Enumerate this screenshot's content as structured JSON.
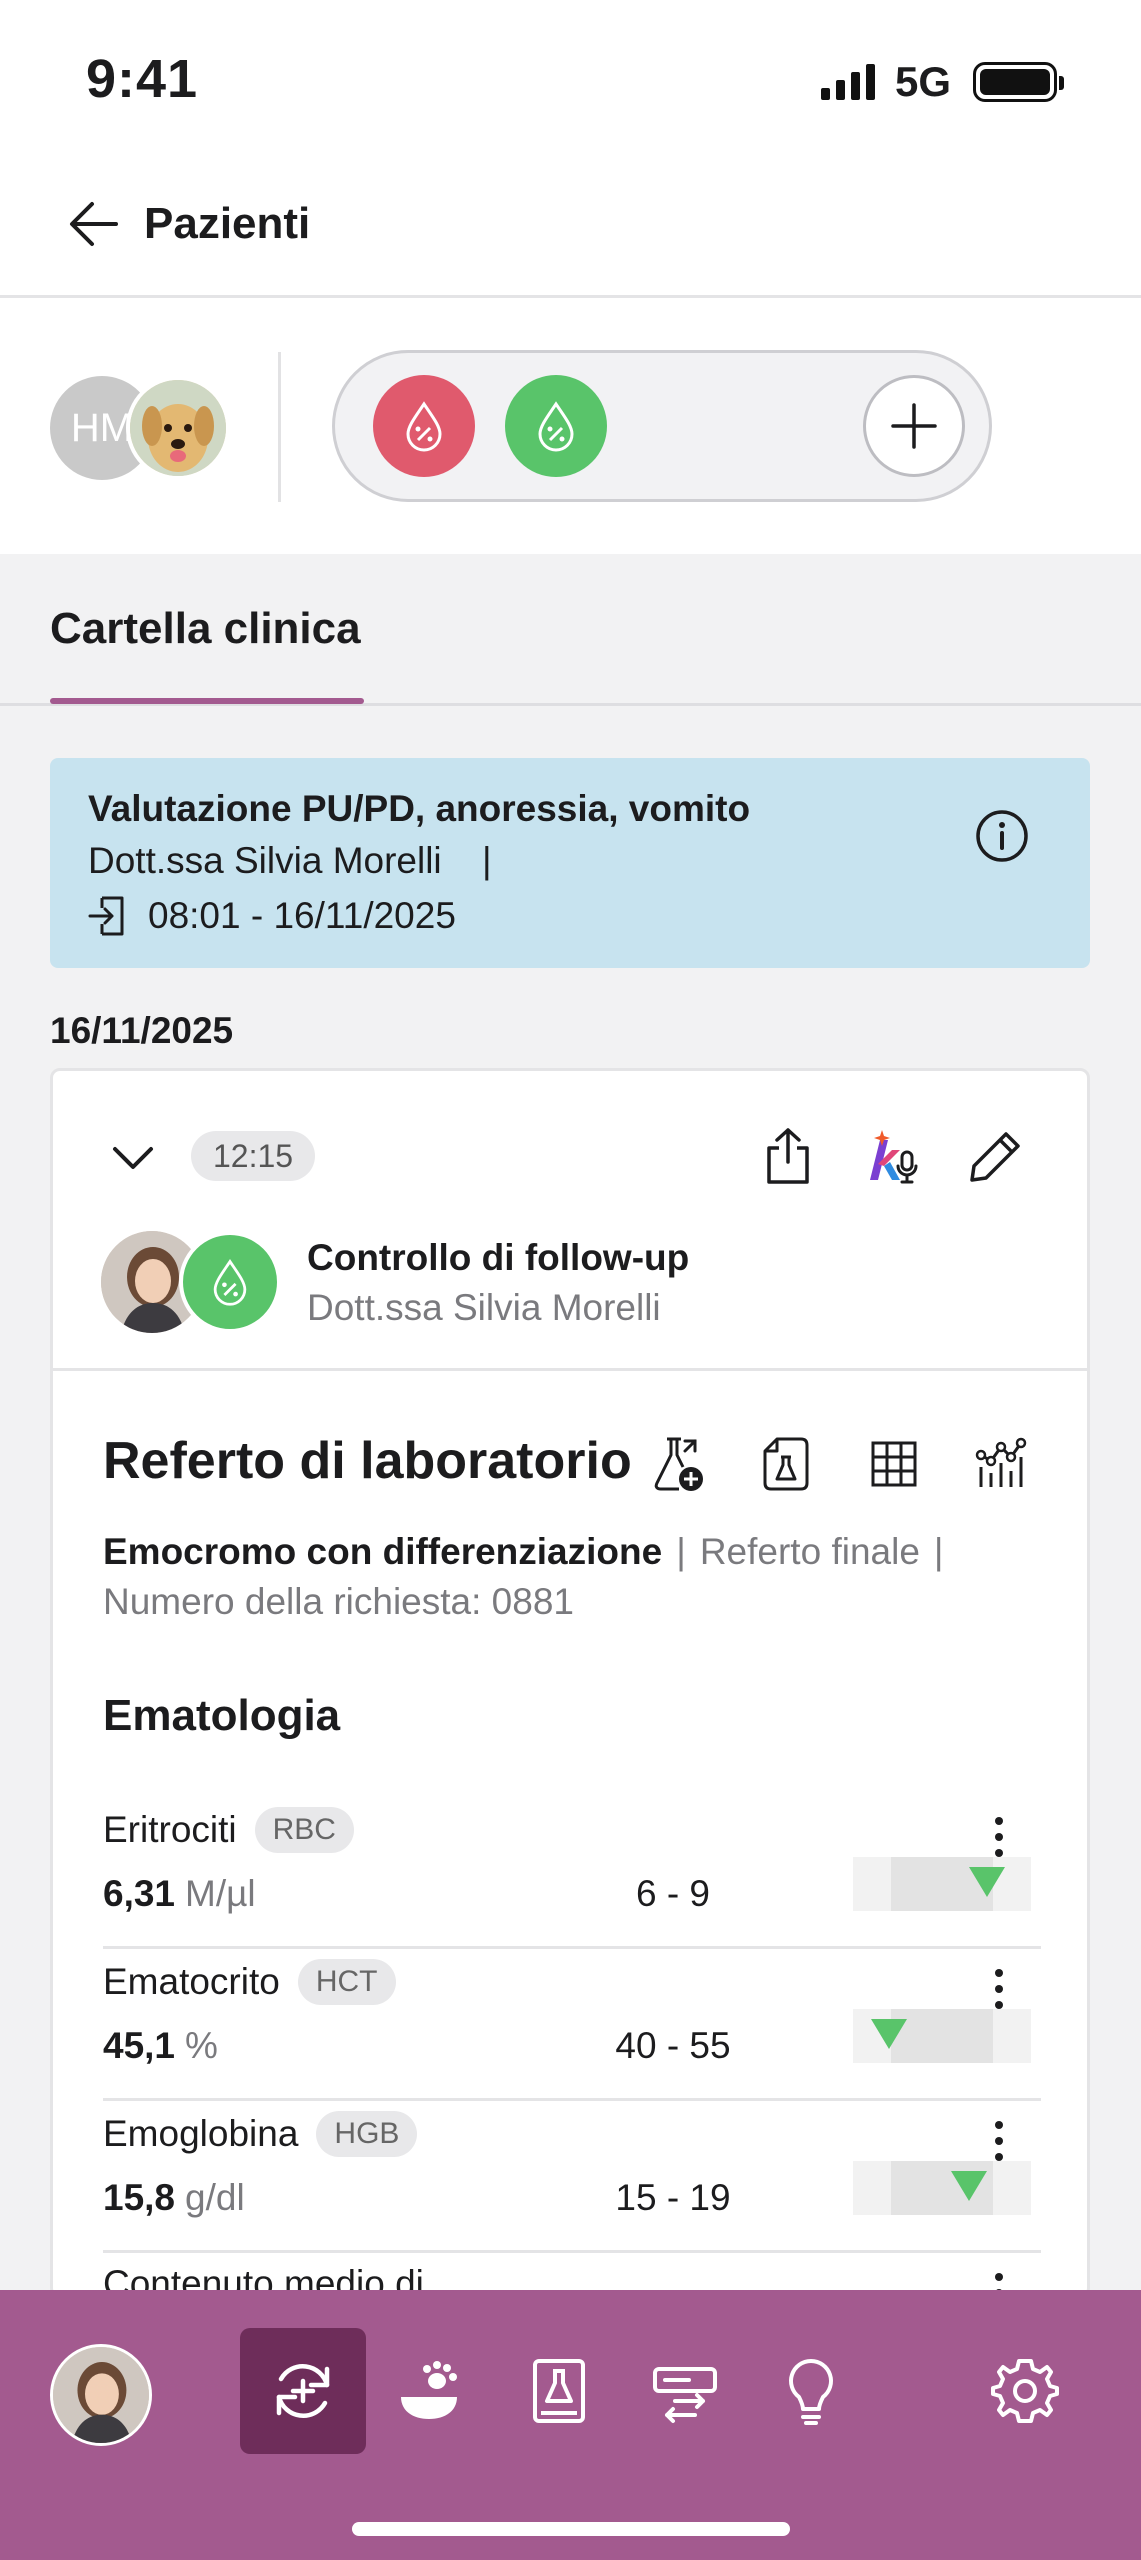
{
  "status": {
    "time": "9:41",
    "network": "5G"
  },
  "nav": {
    "back_label": "Pazienti"
  },
  "patient": {
    "initials": "HM"
  },
  "tabs": [
    {
      "label": "Cartella clinica"
    }
  ],
  "visit": {
    "title": "Valutazione PU/PD, anoressia, vomito",
    "doctor": "Dott.ssa Silvia Morelli",
    "doctor_sep": "|",
    "time": "08:01 - 16/11/2025"
  },
  "date_label": "16/11/2025",
  "entry": {
    "time": "12:15",
    "title": "Controllo di follow-up",
    "doctor": "Dott.ssa Silvia Morelli"
  },
  "lab": {
    "title": "Referto di laboratorio",
    "test_name": "Emocromo con differenziazione",
    "sep": "|",
    "status": "Referto finale",
    "request_label": "Numero della richiesta: 0881",
    "section": "Ematologia",
    "results": [
      {
        "name": "Eritrociti",
        "code": "RBC",
        "value": "6,31",
        "unit": "M/µl",
        "range": "6 - 9",
        "position_fraction": 0.75
      },
      {
        "name": "Ematocrito",
        "code": "HCT",
        "value": "45,1",
        "unit": "%",
        "range": "40 - 55",
        "position_fraction": 0.2
      },
      {
        "name": "Emoglobina",
        "code": "HGB",
        "value": "15,8",
        "unit": "g/dl",
        "range": "15 - 19",
        "position_fraction": 0.65
      },
      {
        "name": "Contenuto medio di",
        "code": "",
        "value": "",
        "unit": "",
        "range": "",
        "position_fraction": null
      }
    ]
  },
  "colors": {
    "accent": "#a35a8f",
    "accent_dark": "#6e2d5a",
    "info_bg": "#c7e3ef",
    "alert_red": "#e05a6d",
    "ok_green": "#59c46a"
  },
  "icons": {
    "bottom_nav": [
      "avatar",
      "refresh-plus-icon",
      "pet-bowl-icon",
      "lab-report-icon",
      "ticket-transfer-icon",
      "lightbulb-icon",
      "gear-icon"
    ]
  }
}
